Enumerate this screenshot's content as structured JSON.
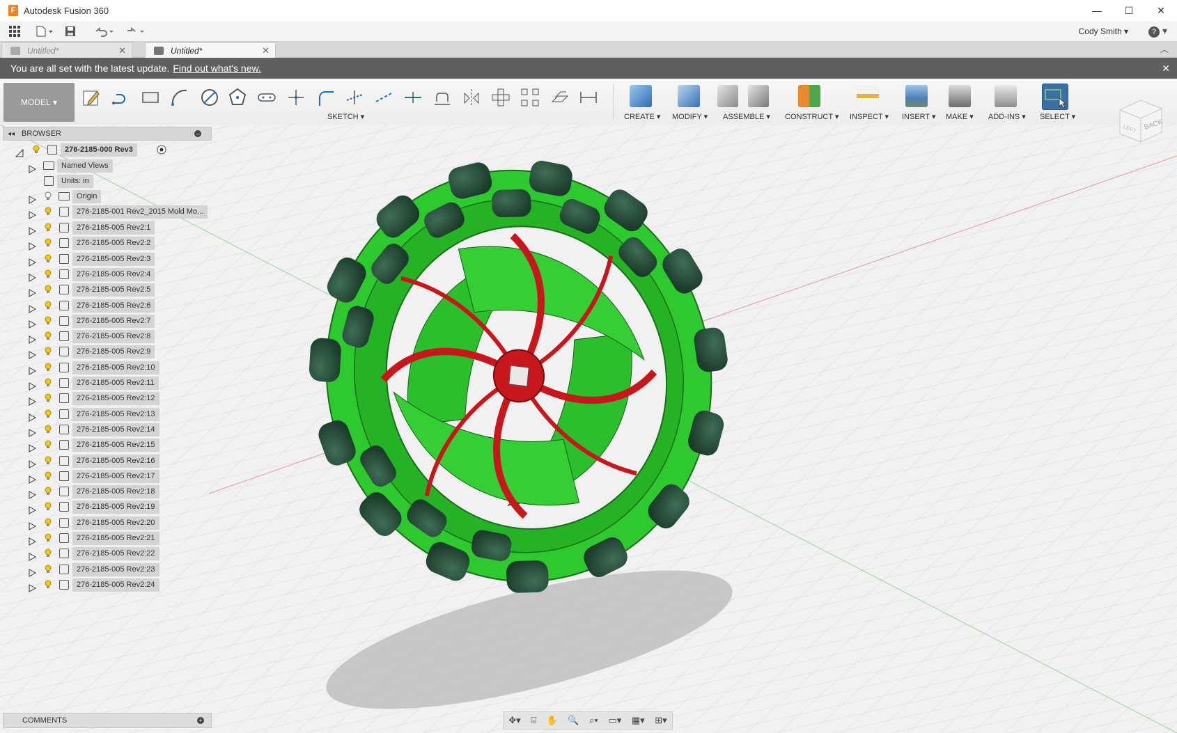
{
  "window": {
    "title": "Autodesk Fusion 360",
    "minimize": "—",
    "maximize": "☐",
    "close": "✕"
  },
  "qat": {
    "user": "Cody Smith ▾",
    "help": "?"
  },
  "tabs": [
    {
      "label": "Untitled*",
      "active": false
    },
    {
      "label": "Untitled*",
      "active": true
    }
  ],
  "update_bar": {
    "message": "You are all set with the latest update.",
    "link": "Find out what's new."
  },
  "ribbon": {
    "workspace": "MODEL",
    "groups": {
      "sketch": "SKETCH",
      "create": "CREATE",
      "modify": "MODIFY",
      "assemble": "ASSEMBLE",
      "construct": "CONSTRUCT",
      "inspect": "INSPECT",
      "insert": "INSERT",
      "make": "MAKE",
      "addins": "ADD-INS",
      "select": "SELECT"
    }
  },
  "browser": {
    "title": "BROWSER",
    "root": "276-2185-000 Rev3",
    "named_views": "Named Views",
    "units": "Units: in",
    "origin": "Origin",
    "mold": "276-2185-001 Rev2_2015 Mold Mo...",
    "components": [
      "276-2185-005 Rev2:1",
      "276-2185-005 Rev2:2",
      "276-2185-005 Rev2:3",
      "276-2185-005 Rev2:4",
      "276-2185-005 Rev2:5",
      "276-2185-005 Rev2:6",
      "276-2185-005 Rev2:7",
      "276-2185-005 Rev2:8",
      "276-2185-005 Rev2:9",
      "276-2185-005 Rev2:10",
      "276-2185-005 Rev2:11",
      "276-2185-005 Rev2:12",
      "276-2185-005 Rev2:13",
      "276-2185-005 Rev2:14",
      "276-2185-005 Rev2:15",
      "276-2185-005 Rev2:16",
      "276-2185-005 Rev2:17",
      "276-2185-005 Rev2:18",
      "276-2185-005 Rev2:19",
      "276-2185-005 Rev2:20",
      "276-2185-005 Rev2:21",
      "276-2185-005 Rev2:22",
      "276-2185-005 Rev2:23",
      "276-2185-005 Rev2:24"
    ]
  },
  "comments": {
    "title": "COMMENTS"
  },
  "viewcube": {
    "back": "BACK",
    "left": "LEFT"
  },
  "colors": {
    "wheel_green": "#2fd12f",
    "roller_dark": "#1f4a32",
    "spoke_red": "#c8161d",
    "update_bar": "#5f5f5f"
  }
}
